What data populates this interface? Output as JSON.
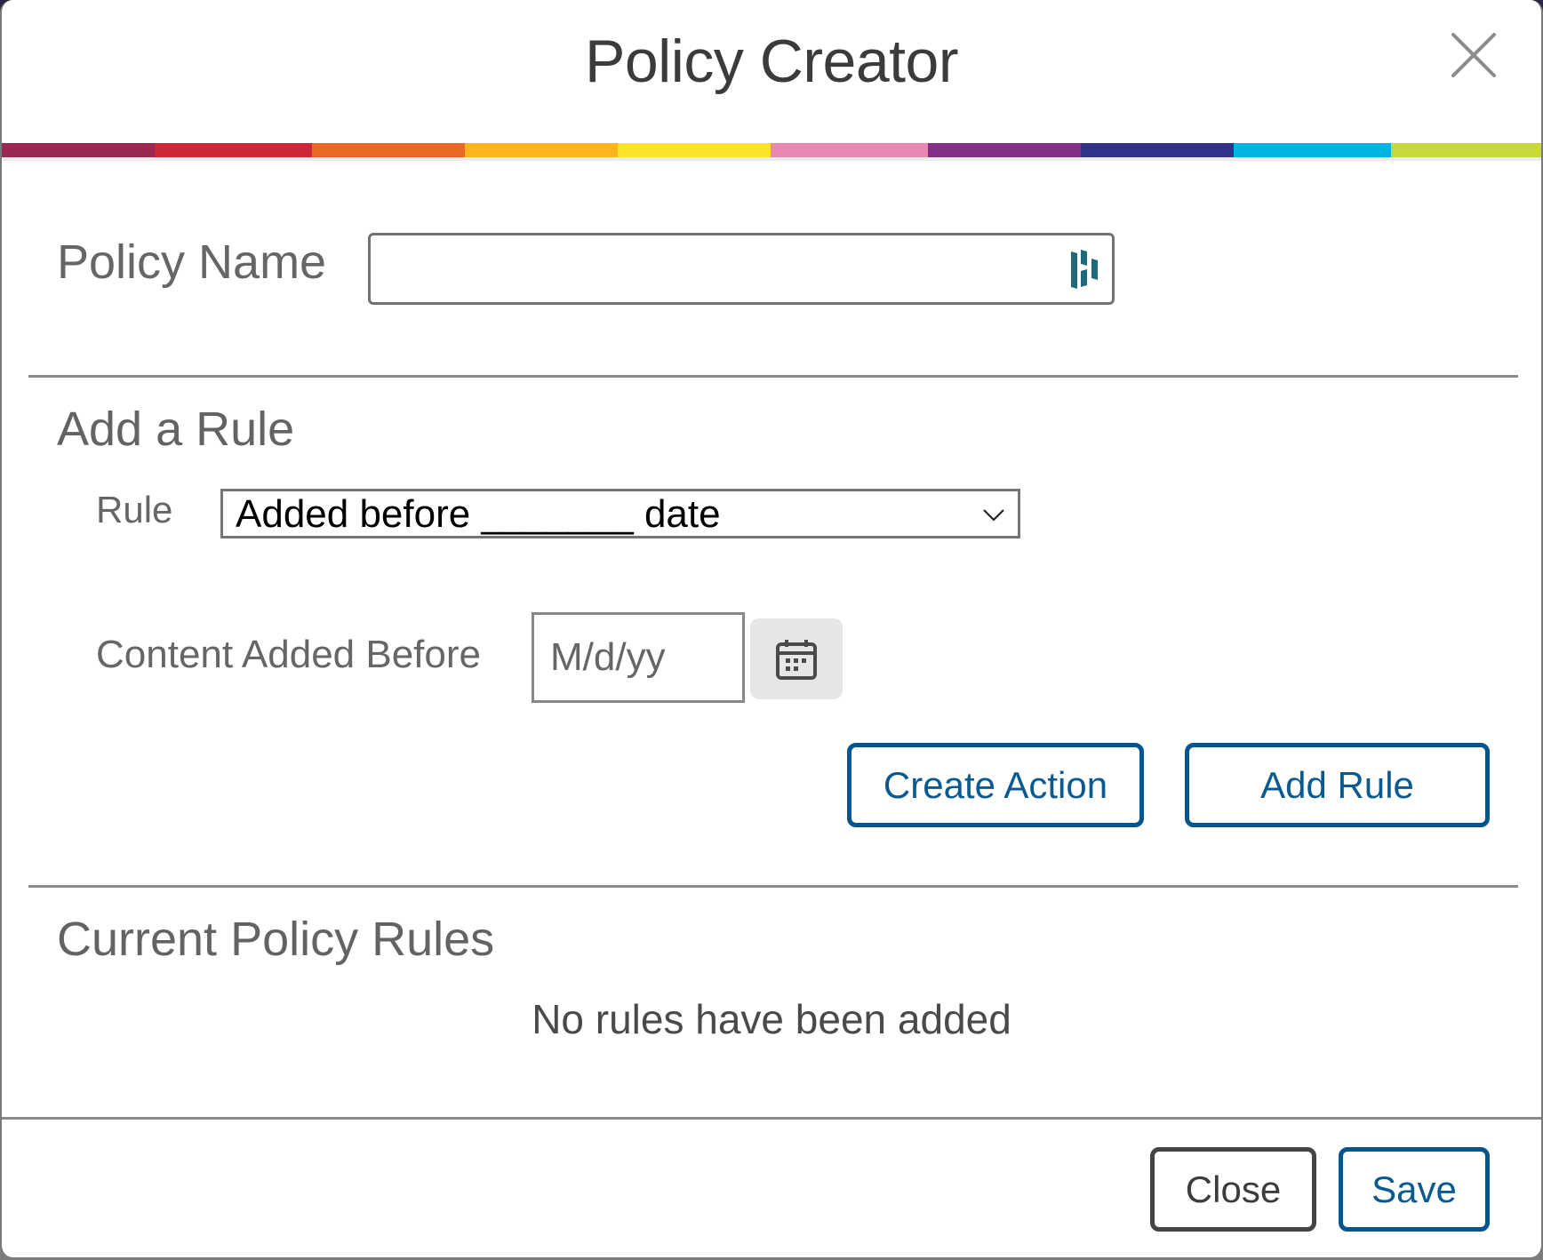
{
  "dialog": {
    "title": "Policy Creator",
    "close_icon": "close-icon"
  },
  "rainbow_colors": [
    "#9b2755",
    "#cd2738",
    "#ea6825",
    "#fcb61b",
    "#fbe32d",
    "#ea88b5",
    "#843086",
    "#31338a",
    "#02b5e1",
    "#c8d73a"
  ],
  "policy_name": {
    "label": "Policy Name",
    "value": "",
    "placeholder": "",
    "password_manager_icon": "password-manager-icon"
  },
  "add_rule_section": {
    "title": "Add a Rule",
    "rule_label": "Rule",
    "rule_selected": "Added before _______ date",
    "content_added_before_label": "Content Added Before",
    "date_placeholder": "M/d/yy",
    "date_value": "",
    "calendar_icon": "calendar-icon",
    "create_action_label": "Create Action",
    "add_rule_label": "Add Rule"
  },
  "current_rules_section": {
    "title": "Current Policy Rules",
    "empty_message": "No rules have been added"
  },
  "footer": {
    "close_label": "Close",
    "save_label": "Save"
  },
  "colors": {
    "accent_blue": "#03558e",
    "dark_button": "#444444"
  }
}
